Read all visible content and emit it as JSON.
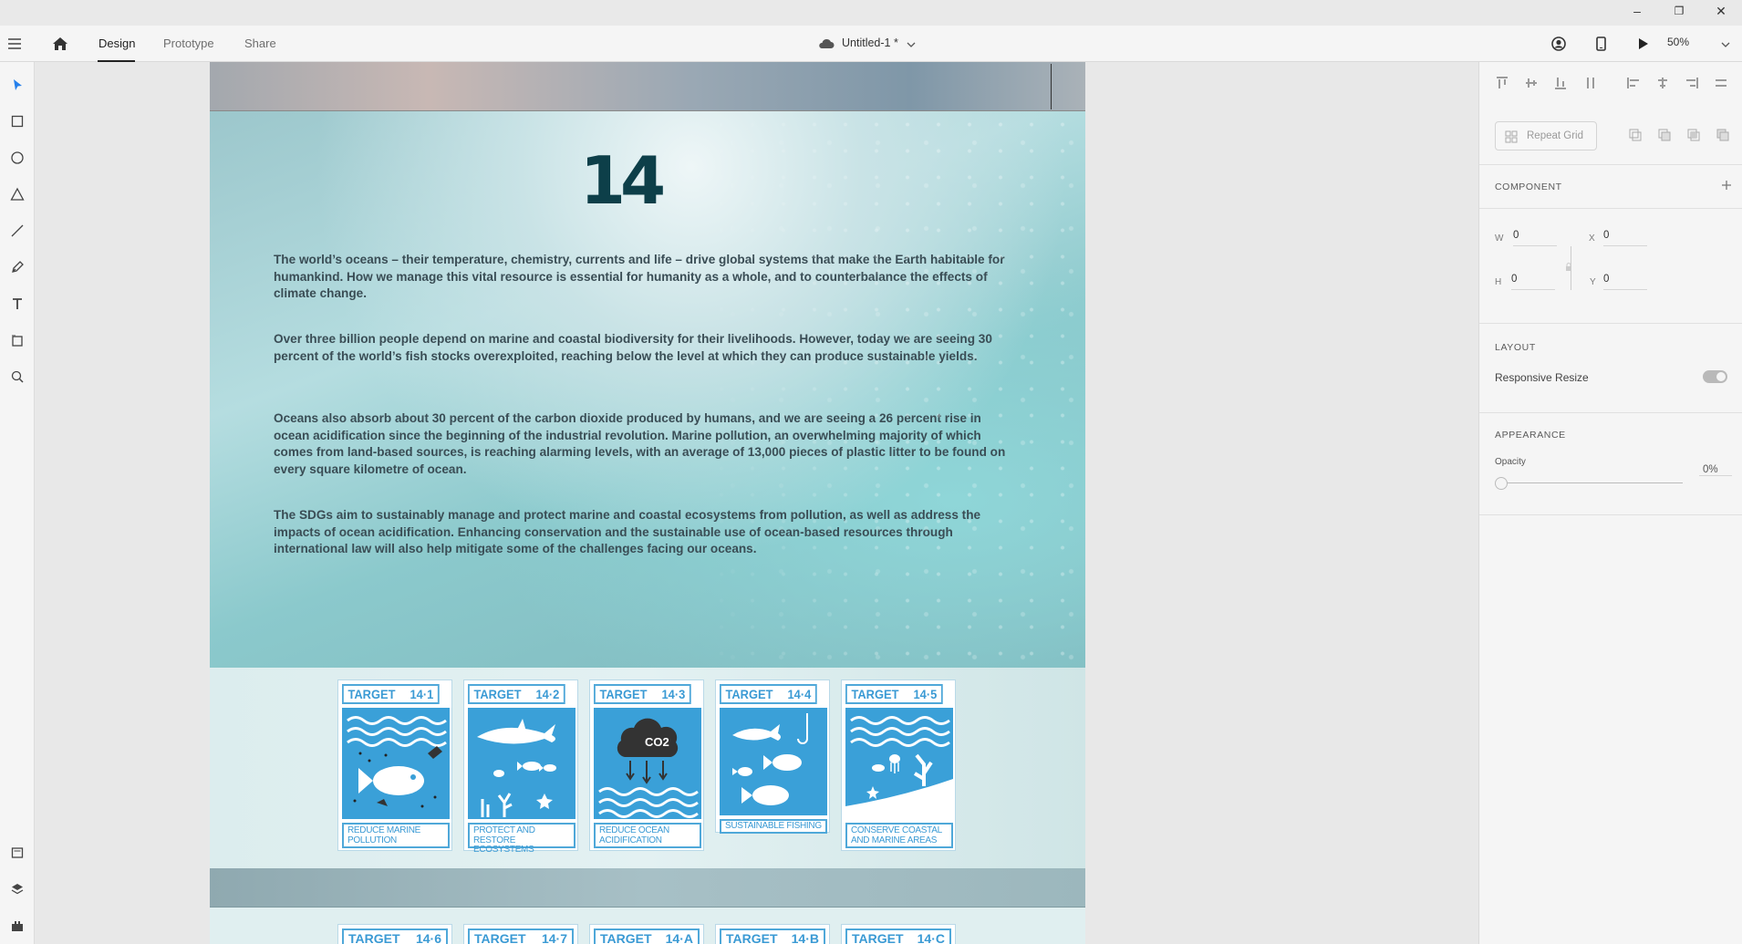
{
  "window": {
    "minimize_glyph": "–",
    "maximize_glyph": "❐",
    "close_glyph": "✕"
  },
  "menu": {
    "tabs": [
      {
        "label": "Design"
      },
      {
        "label": "Prototype"
      },
      {
        "label": "Share"
      }
    ],
    "document_title": "Untitled-1 *",
    "zoom": "50%"
  },
  "artboard": {
    "goal_number": "14",
    "paragraphs": [
      "The world’s oceans – their temperature, chemistry, currents and life – drive global systems that make the Earth habitable for humankind. How we manage this vital resource is essential for humanity as a whole, and to counterbalance the effects of climate change.",
      "Over three billion people depend on marine and coastal biodiversity for their livelihoods. However, today we are seeing 30 percent of the world’s fish stocks overexploited, reaching below the level at which they can produce sustainable yields.",
      "Oceans also absorb about 30 percent of the carbon dioxide produced by humans, and we are seeing a 26 percent rise in ocean acidification since the beginning of the industrial revolution. Marine pollution, an overwhelming majority of which comes from land-based sources, is reaching alarming levels, with an average of 13,000 pieces of plastic litter to be found on every square kilometre of ocean.",
      "The SDGs aim to sustainably manage and protect marine and coastal ecosystems from pollution, as well as address the impacts of ocean acidification. Enhancing conservation and the sustainable use of ocean-based resources through international law will also help mitigate some of the challenges facing our oceans."
    ],
    "targets": [
      {
        "word": "TARGET",
        "num": "14·1",
        "label": "REDUCE MARINE POLLUTION",
        "icon": "fish-pollution-icon"
      },
      {
        "word": "TARGET",
        "num": "14·2",
        "label": "PROTECT AND RESTORE ECOSYSTEMS",
        "icon": "shark-coral-icon"
      },
      {
        "word": "TARGET",
        "num": "14·3",
        "label": "REDUCE OCEAN ACIDIFICATION",
        "icon": "co2-cloud-icon",
        "co2": "CO2"
      },
      {
        "word": "TARGET",
        "num": "14·4",
        "label": "SUSTAINABLE FISHING",
        "icon": "fishes-hook-icon"
      },
      {
        "word": "TARGET",
        "num": "14·5",
        "label": "CONSERVE COASTAL AND MARINE AREAS",
        "icon": "coastal-coral-icon"
      }
    ],
    "targets_row2": [
      {
        "word": "TARGET",
        "num": "14·6"
      },
      {
        "word": "TARGET",
        "num": "14·7"
      },
      {
        "word": "TARGET",
        "num": "14·A"
      },
      {
        "word": "TARGET",
        "num": "14·B"
      },
      {
        "word": "TARGET",
        "num": "14·C"
      }
    ]
  },
  "inspector": {
    "repeat_grid": "Repeat Grid",
    "component_title": "COMPONENT",
    "w_label": "W",
    "w_value": "0",
    "x_label": "X",
    "x_value": "0",
    "h_label": "H",
    "h_value": "0",
    "y_label": "Y",
    "y_value": "0",
    "layout_title": "LAYOUT",
    "responsive_resize": "Responsive Resize",
    "responsive_resize_on": true,
    "appearance_title": "APPEARANCE",
    "opacity_label": "Opacity",
    "opacity_value": "0%"
  },
  "colors": {
    "accent": "#2680eb",
    "sdg_blue": "#3aa0d8",
    "goal_teal": "#0d3f49"
  }
}
